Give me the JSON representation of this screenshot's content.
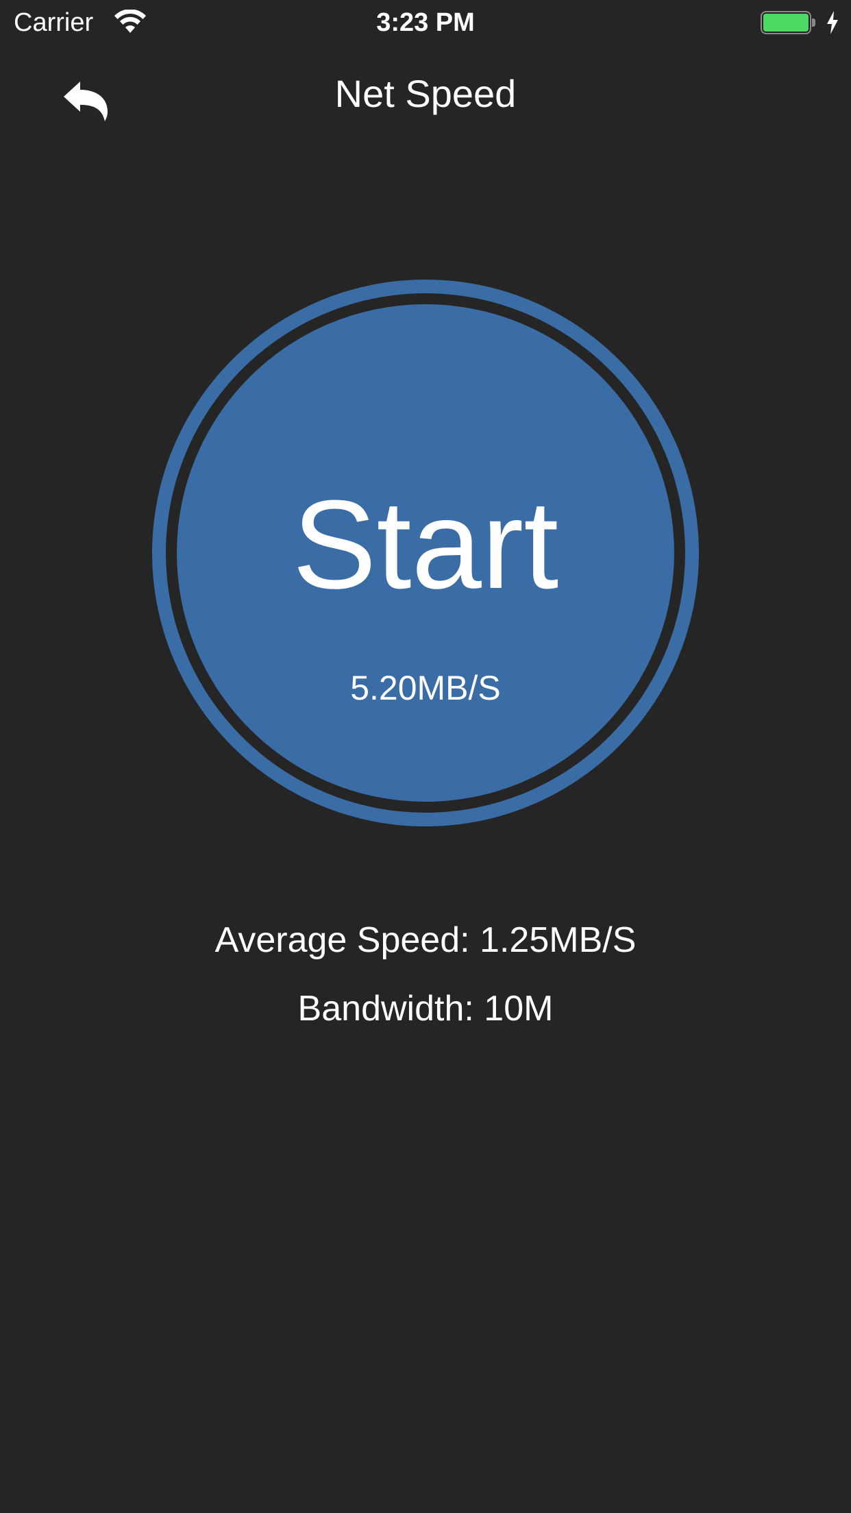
{
  "status_bar": {
    "carrier": "Carrier",
    "time": "3:23 PM",
    "battery_level": 1.0,
    "charging": true,
    "icons": [
      "wifi-icon",
      "battery-icon",
      "charging-bolt-icon"
    ]
  },
  "nav": {
    "title": "Net Speed",
    "back_icon": "undo-arrow-icon"
  },
  "dial": {
    "button_label": "Start",
    "current_speed": "5.20MB/S"
  },
  "stats": {
    "average_speed": "Average Speed: 1.25MB/S",
    "bandwidth": "Bandwidth: 10M"
  },
  "colors": {
    "background": "#252525",
    "accent": "#3a6ca5",
    "text": "#ffffff",
    "battery": "#4cd964"
  }
}
